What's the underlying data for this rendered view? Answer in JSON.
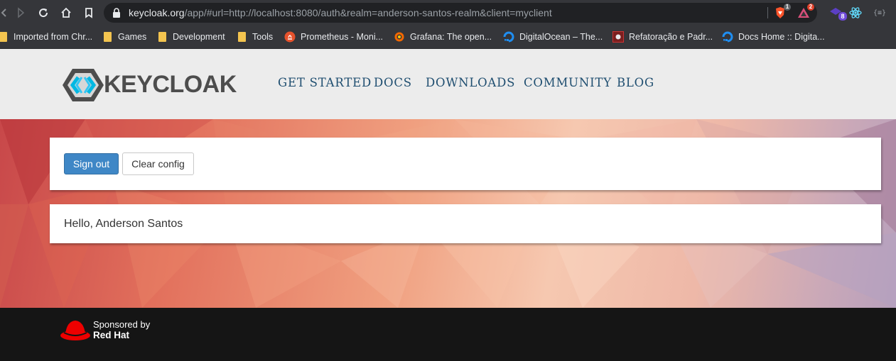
{
  "browser": {
    "url_host": "keycloak.org",
    "url_path": "/app/#url=http://localhost:8080/auth&realm=anderson-santos-realm&client=myclient",
    "extensions": [
      {
        "name": "brave-shields",
        "badge": "1"
      },
      {
        "name": "brave-rewards",
        "badge": "2"
      },
      {
        "name": "extension-purple",
        "badge": "8"
      },
      {
        "name": "react-devtools",
        "badge": ""
      },
      {
        "name": "json-viewer",
        "label": "{≡}"
      }
    ]
  },
  "bookmarks": [
    {
      "label": "Imported from Chr...",
      "icon": "folder-icon"
    },
    {
      "label": "Games",
      "icon": "folder-icon"
    },
    {
      "label": "Development",
      "icon": "folder-icon"
    },
    {
      "label": "Tools",
      "icon": "folder-icon"
    },
    {
      "label": "Prometheus - Moni...",
      "icon": "prometheus-icon"
    },
    {
      "label": "Grafana: The open...",
      "icon": "grafana-icon"
    },
    {
      "label": "DigitalOcean – The...",
      "icon": "digitalocean-icon"
    },
    {
      "label": "Refatoração e Padr...",
      "icon": "refactoring-icon"
    },
    {
      "label": "Docs Home :: Digita...",
      "icon": "digitalocean-icon"
    }
  ],
  "site": {
    "logo_text": "KEYCLOAK",
    "nav": [
      "GET STARTED",
      "DOCS",
      "DOWNLOADS",
      "COMMUNITY",
      "BLOG"
    ]
  },
  "app": {
    "sign_out_label": "Sign out",
    "clear_config_label": "Clear config",
    "greeting": "Hello, Anderson Santos"
  },
  "footer": {
    "sponsored_by": "Sponsored by",
    "sponsor_name": "Red Hat"
  },
  "colors": {
    "primary_button": "#3f87c6",
    "nav_text": "#1f4e70",
    "footer_bg": "#151515",
    "redhat_red": "#ee0000"
  }
}
